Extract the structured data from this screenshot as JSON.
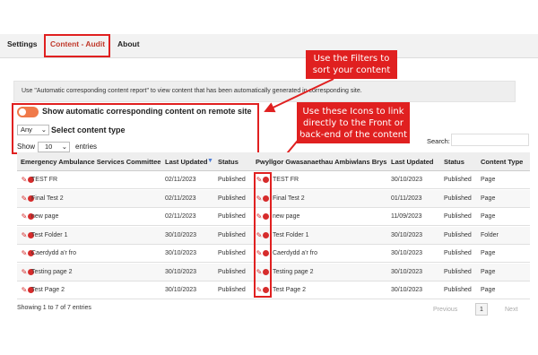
{
  "tabs": [
    {
      "label": "Settings"
    },
    {
      "label": "Content - Audit"
    },
    {
      "label": "About"
    }
  ],
  "info_text": "Use \"Automatic corresponding content report\" to view content that has been automatically generated in corresponding site.",
  "callouts": {
    "filters": "Use the Filters to sort your content",
    "icons": "Use these Icons to link directly to the Front or back-end of the content"
  },
  "filters": {
    "toggle_label": "Show automatic corresponding content on remote site",
    "content_type_value": "Any",
    "content_type_label": "Select content type",
    "show_label": "Show",
    "show_value": "10",
    "entries_label": "entries",
    "search_label": "Search:"
  },
  "table": {
    "headers": [
      "Emergency Ambulance Services Committee",
      "Last Updated",
      "Status",
      "Pwyllgor Gwasanaethau Ambiwlans Brys",
      "Last Updated",
      "Status",
      "Content Type"
    ],
    "rows": [
      {
        "title": "TEST FR",
        "updated": "02/11/2023",
        "status": "Published",
        "remote_title": "TEST FR",
        "remote_updated": "30/10/2023",
        "remote_status": "Published",
        "type": "Page"
      },
      {
        "title": "Final Test 2",
        "updated": "02/11/2023",
        "status": "Published",
        "remote_title": "Final Test 2",
        "remote_updated": "01/11/2023",
        "remote_status": "Published",
        "type": "Page"
      },
      {
        "title": "new page",
        "updated": "02/11/2023",
        "status": "Published",
        "remote_title": "new page",
        "remote_updated": "11/09/2023",
        "remote_status": "Published",
        "type": "Page"
      },
      {
        "title": "Test Folder 1",
        "updated": "30/10/2023",
        "status": "Published",
        "remote_title": "Test Folder 1",
        "remote_updated": "30/10/2023",
        "remote_status": "Published",
        "type": "Folder"
      },
      {
        "title": "Caerdydd a'r fro",
        "updated": "30/10/2023",
        "status": "Published",
        "remote_title": "Caerdydd a'r fro",
        "remote_updated": "30/10/2023",
        "remote_status": "Published",
        "type": "Page"
      },
      {
        "title": "Testing page 2",
        "updated": "30/10/2023",
        "status": "Published",
        "remote_title": "Testing page 2",
        "remote_updated": "30/10/2023",
        "remote_status": "Published",
        "type": "Page"
      },
      {
        "title": "Test Page 2",
        "updated": "30/10/2023",
        "status": "Published",
        "remote_title": "Test Page 2",
        "remote_updated": "30/10/2023",
        "remote_status": "Published",
        "type": "Page"
      }
    ]
  },
  "footer": {
    "info": "Showing 1 to 7 of 7 entries",
    "previous": "Previous",
    "page": "1",
    "next": "Next"
  },
  "colors": {
    "accent": "#e02020",
    "toggle": "#f07a4a",
    "icon": "#d62b2b"
  },
  "icons": [
    "pencil-icon",
    "globe-icon",
    "sort-desc-icon",
    "chevron-down-icon"
  ]
}
